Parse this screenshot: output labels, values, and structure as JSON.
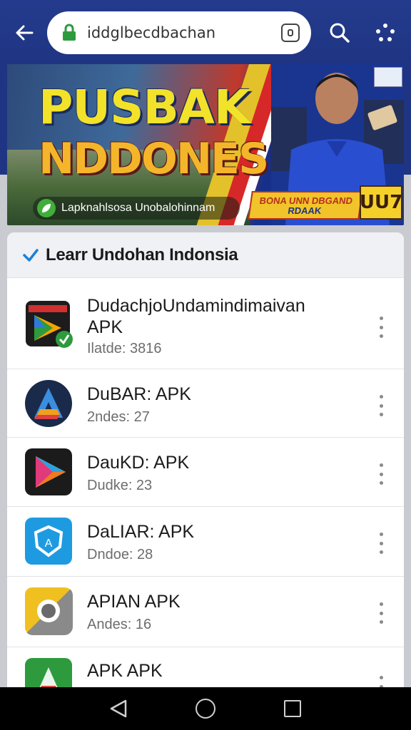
{
  "browser": {
    "url": "iddglbecdbachan"
  },
  "banner": {
    "title_line1": "PUSBAK",
    "title_line2": "NDDONESIA",
    "caption": "Lapknahlsosa Unobalohinnam",
    "promo_line1": "BONA UNN DBGAND",
    "promo_line2": "RDAAK",
    "promo_number": "UU7"
  },
  "card": {
    "title": "Learr Undohan Indonsia",
    "apps": [
      {
        "name": "DudachjoUndamindimaivan APK",
        "meta": "Ilatde: 3816",
        "icon": "app-store-dark-icon"
      },
      {
        "name": "DuBAR: APK",
        "meta": "2ndes: 27",
        "icon": "arrow-logo-icon"
      },
      {
        "name": "DauKD: APK",
        "meta": "Dudke: 23",
        "icon": "play-triangle-icon"
      },
      {
        "name": "DaLIAR: APK",
        "meta": "Dndoe: 28",
        "icon": "blue-shield-icon"
      },
      {
        "name": "APIAN APK",
        "meta": "Andes: 16",
        "icon": "camera-lens-icon"
      },
      {
        "name": "APK APK",
        "meta": "",
        "icon": "green-arrow-icon"
      }
    ]
  },
  "colors": {
    "browser_bar": "#1f3583",
    "secure_lock": "#2e9a3e",
    "card_header_bg": "#eff1f4",
    "check_accent": "#1e7fd6"
  }
}
